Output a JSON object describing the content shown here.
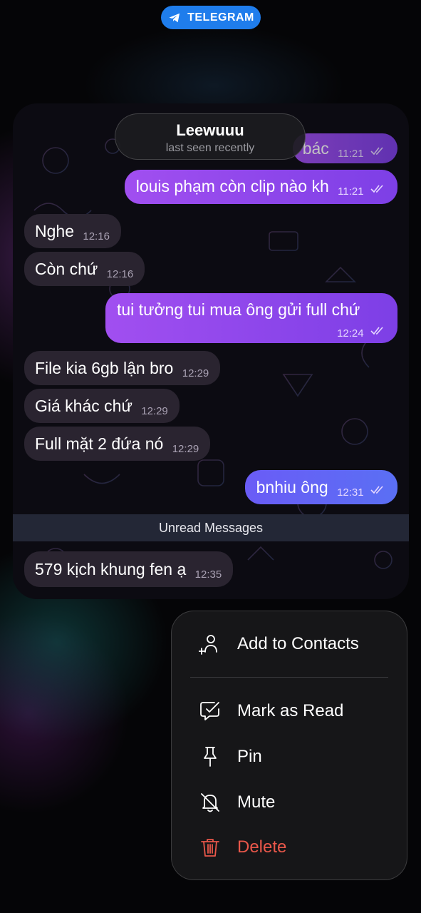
{
  "app_badge": {
    "label": "TELEGRAM",
    "icon": "telegram-plane-icon",
    "color": "#1f7dec"
  },
  "chat": {
    "name": "Leewuuu",
    "status": "last seen recently",
    "messages": [
      {
        "dir": "out",
        "text": "bác",
        "time": "11:21",
        "read": true
      },
      {
        "dir": "out",
        "text": "louis phạm còn clip nào kh",
        "time": "11:21",
        "read": true
      },
      {
        "dir": "in",
        "text": "Nghe",
        "time": "12:16"
      },
      {
        "dir": "in",
        "text": "Còn chứ",
        "time": "12:16"
      },
      {
        "dir": "out",
        "text": "tui tưởng tui mua ông gửi full chứ",
        "time": "12:24",
        "read": true
      },
      {
        "dir": "in",
        "text": "File kia 6gb lận bro",
        "time": "12:29"
      },
      {
        "dir": "in",
        "text": "Giá khác chứ",
        "time": "12:29"
      },
      {
        "dir": "in",
        "text": "Full mặt 2 đứa nó",
        "time": "12:29"
      },
      {
        "dir": "out",
        "text": "bnhiu ông",
        "time": "12:31",
        "read": true
      },
      {
        "dir": "in",
        "text": "579 kịch khung fen ạ",
        "time": "12:35"
      }
    ],
    "unread_label": "Unread Messages",
    "colors": {
      "outgoing": "#9b4cf0",
      "outgoing_last": "#6466f5",
      "incoming": "#2a2430"
    }
  },
  "menu": {
    "items": [
      {
        "label": "Add to Contacts",
        "icon": "add-contact-icon"
      },
      {
        "label": "Mark as Read",
        "icon": "mark-read-icon"
      },
      {
        "label": "Pin",
        "icon": "pin-icon"
      },
      {
        "label": "Mute",
        "icon": "bell-off-icon"
      },
      {
        "label": "Delete",
        "icon": "trash-icon",
        "color": "#e9574a"
      }
    ]
  }
}
